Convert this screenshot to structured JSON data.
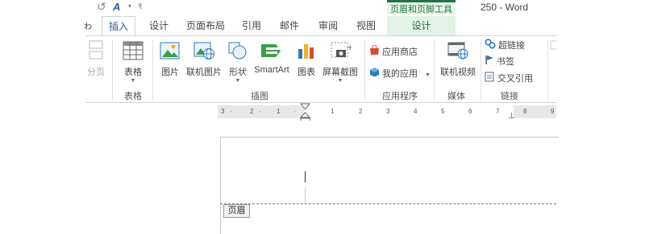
{
  "window": {
    "title": "250 - Word"
  },
  "qat": {
    "undo_icon": "undo-icon",
    "format_icon": "text-effects-icon",
    "dropdown": "▾",
    "customize": "₹"
  },
  "context_tools": {
    "title": "页眉和页脚工具"
  },
  "tabs": [
    {
      "label": "ゎ"
    },
    {
      "label": "插入"
    },
    {
      "label": "设计"
    },
    {
      "label": "页面布局"
    },
    {
      "label": "引用"
    },
    {
      "label": "邮件"
    },
    {
      "label": "审阅"
    },
    {
      "label": "视图"
    },
    {
      "label": "设计"
    }
  ],
  "ribbon": {
    "page_break": {
      "label": "分页"
    },
    "table_group": {
      "label": "表格",
      "table_button": "表格"
    },
    "illustrations": {
      "label": "插图",
      "pictures": "图片",
      "online_pictures": "联机图片",
      "shapes": "形状",
      "smartart": "SmartArt",
      "chart": "图表",
      "screenshot": "屏幕截图"
    },
    "apps": {
      "label": "应用程序",
      "store": "应用商店",
      "my_apps": "我的应用"
    },
    "media": {
      "label": "媒体",
      "online_video": "联机视频"
    },
    "links": {
      "label": "链接",
      "hyperlink": "超链接",
      "bookmark": "书签",
      "cross_ref": "交叉引用"
    }
  },
  "ruler": {
    "labels": [
      "3",
      "2",
      "1",
      "1",
      "2",
      "3",
      "4",
      "5",
      "6",
      "7",
      "8",
      "9"
    ]
  },
  "document": {
    "header_tag": "页眉"
  },
  "colors": {
    "accent": "#2b579a",
    "context_green": "#217346"
  }
}
